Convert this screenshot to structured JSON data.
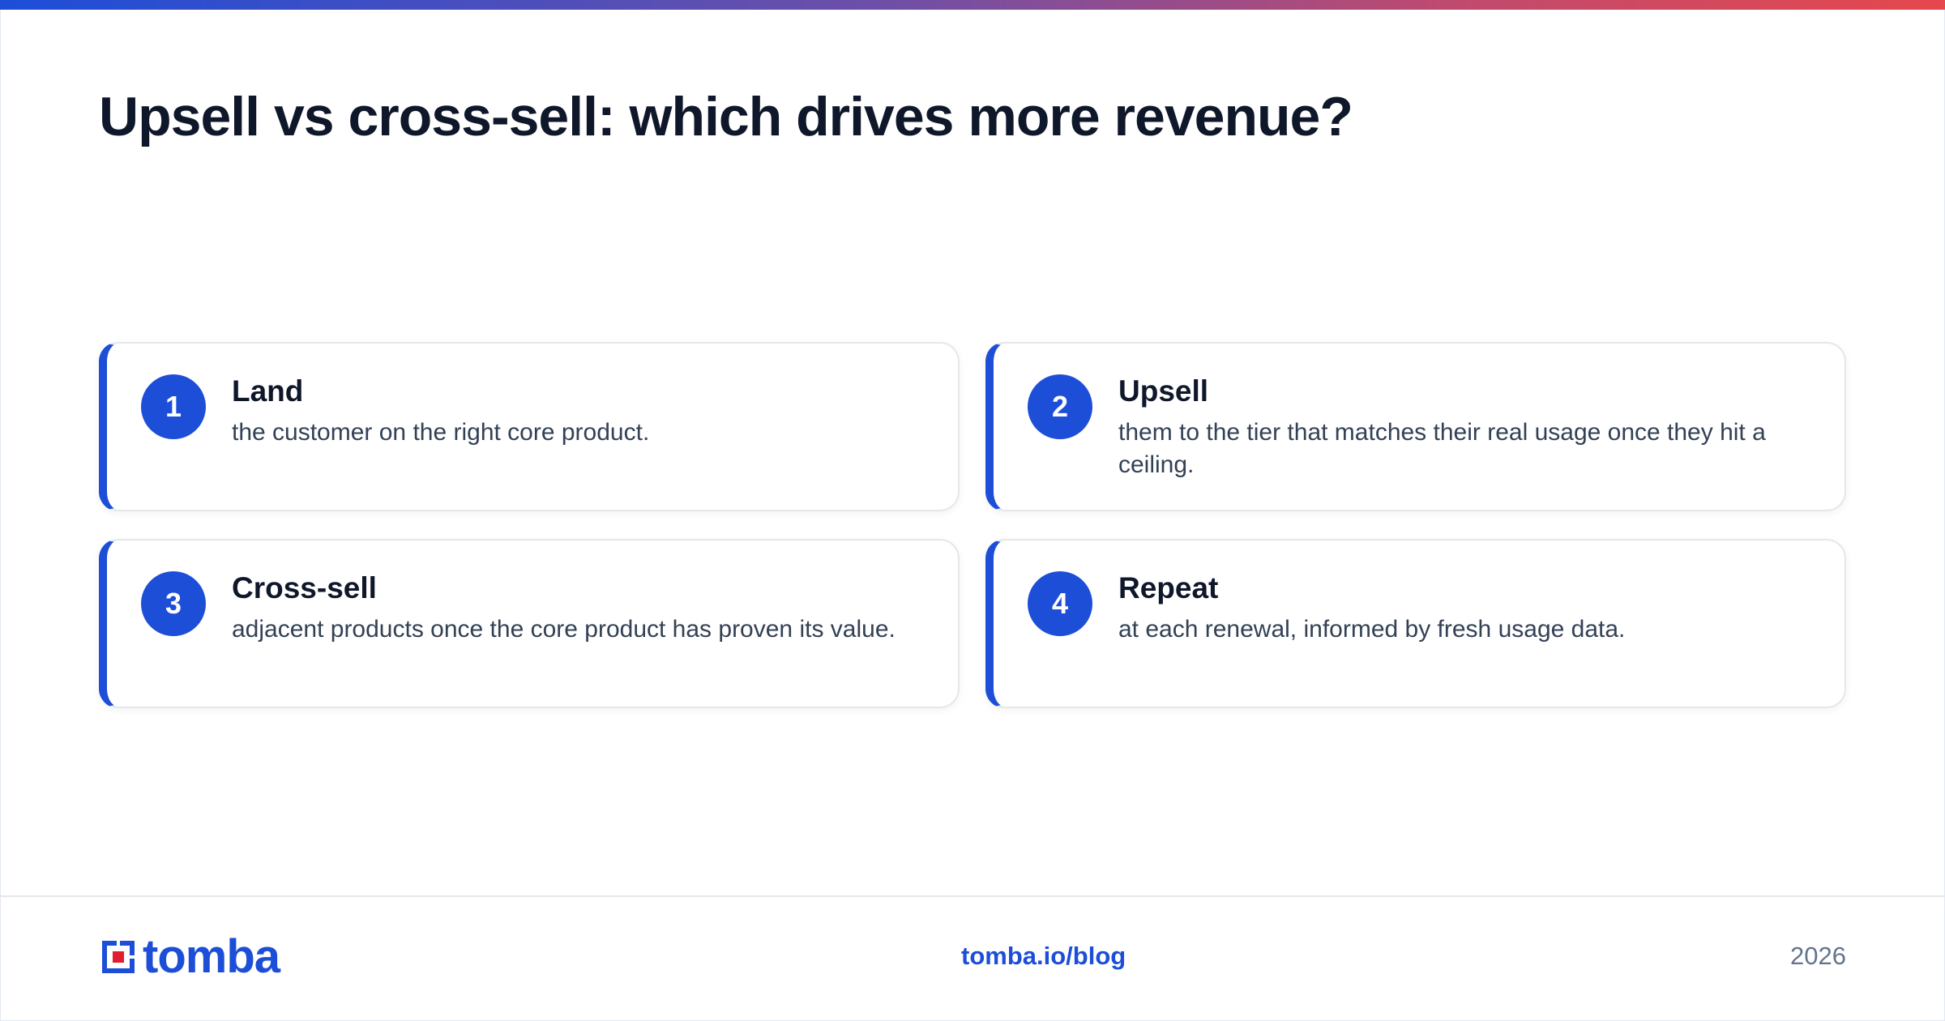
{
  "header": {
    "title": "Upsell vs cross-sell: which drives more revenue?"
  },
  "steps": [
    {
      "number": "1",
      "title": "Land",
      "description": "the customer on the right core product."
    },
    {
      "number": "2",
      "title": "Upsell",
      "description": "them to the tier that matches their real usage once they hit a ceiling."
    },
    {
      "number": "3",
      "title": "Cross-sell",
      "description": "adjacent products once the core product has proven its value."
    },
    {
      "number": "4",
      "title": "Repeat",
      "description": "at each renewal, informed by fresh usage data."
    }
  ],
  "footer": {
    "logo_text": "tomba",
    "link": "tomba.io/blog",
    "year": "2026"
  },
  "colors": {
    "accent": "#1d4ed8",
    "logo_red": "#e11d2e",
    "gradient_start": "#1d4ed8",
    "gradient_end": "#e5484d"
  }
}
